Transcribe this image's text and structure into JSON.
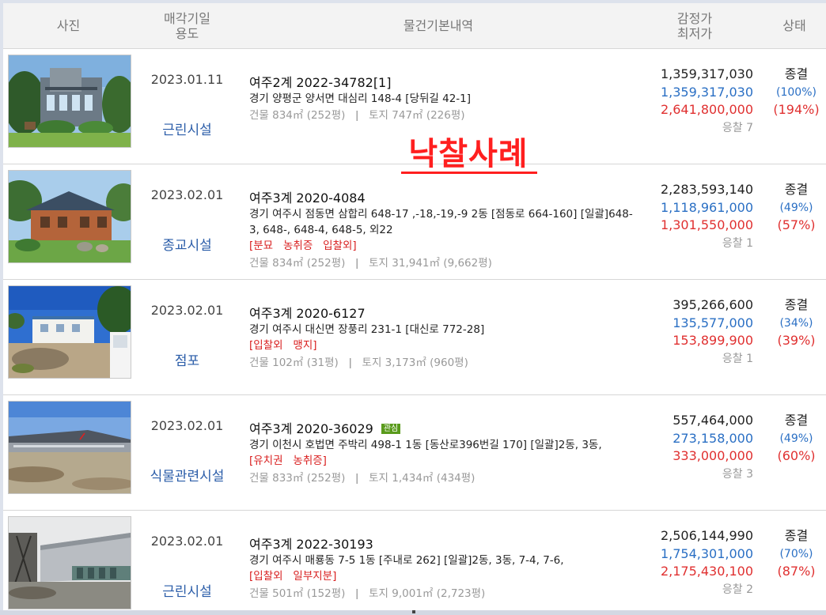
{
  "header": {
    "photo": "사진",
    "date_l1": "매각기일",
    "date_l2": "용도",
    "info": "물건기본내역",
    "price_l1": "감정가",
    "price_l2": "최저가",
    "status": "상태"
  },
  "overlay_text": "낙찰사례",
  "rows": [
    {
      "date": "2023.01.11",
      "usage": "근린시설",
      "case": "여주2계 2022-34782[1]",
      "badge": "",
      "addr": "경기 양평군 양서면 대심리 148-4 [당뒤길 42-1]",
      "tags": "",
      "area": "건물 834㎡ (252평)   ǀ   토지 747㎡ (226평)",
      "appraisal": "1,359,317,030",
      "minimum": "1,359,317,030",
      "sale": "2,641,800,000",
      "bids": "응찰 7",
      "state": "종결",
      "pct_min": "(100%)",
      "pct_sale": "(194%)"
    },
    {
      "date": "2023.02.01",
      "usage": "종교시설",
      "case": "여주3계 2020-4084",
      "badge": "",
      "addr": "경기 여주시 점동면 삼합리 648-17 ,-18,-19,-9 2동 [점동로 664-160] [일괄]648-3, 648-, 648-4, 648-5, 외22",
      "tags": "[분묘   농취증   입찰외]",
      "area": "건물 834㎡ (252평)   ǀ   토지 31,941㎡ (9,662평)",
      "appraisal": "2,283,593,140",
      "minimum": "1,118,961,000",
      "sale": "1,301,550,000",
      "bids": "응찰 1",
      "state": "종결",
      "pct_min": "(49%)",
      "pct_sale": "(57%)"
    },
    {
      "date": "2023.02.01",
      "usage": "점포",
      "case": "여주3계 2020-6127",
      "badge": "",
      "addr": "경기 여주시 대신면 장풍리 231-1 [대신로 772-28]",
      "tags": "[입찰외   맹지]",
      "area": "건물 102㎡ (31평)   ǀ   토지 3,173㎡ (960평)",
      "appraisal": "395,266,600",
      "minimum": "135,577,000",
      "sale": "153,899,900",
      "bids": "응찰 1",
      "state": "종결",
      "pct_min": "(34%)",
      "pct_sale": "(39%)"
    },
    {
      "date": "2023.02.01",
      "usage": "식물관련시설",
      "case": "여주3계 2020-36029",
      "badge": "관심",
      "addr": "경기 이천시 호법면 주박리 498-1 1동 [동산로396번길 170]  [일괄]2동, 3동,",
      "tags": "[유치권   농취증]",
      "area": "건물 833㎡ (252평)   ǀ   토지 1,434㎡ (434평)",
      "appraisal": "557,464,000",
      "minimum": "273,158,000",
      "sale": "333,000,000",
      "bids": "응찰 3",
      "state": "종결",
      "pct_min": "(49%)",
      "pct_sale": "(60%)"
    },
    {
      "date": "2023.02.01",
      "usage": "근린시설",
      "case": "여주3계 2022-30193",
      "badge": "",
      "addr": "경기 여주시 매룡동 7-5 1동 [주내로 262]  [일괄]2동, 3동, 7-4, 7-6,",
      "tags": "[입찰외   일부지분]",
      "area": "건물 501㎡ (152평)   ǀ   토지 9,001㎡ (2,723평)",
      "appraisal": "2,506,144,990",
      "minimum": "1,754,301,000",
      "sale": "2,175,430,100",
      "bids": "응찰 2",
      "state": "종결",
      "pct_min": "(70%)",
      "pct_sale": "(87%)"
    }
  ]
}
